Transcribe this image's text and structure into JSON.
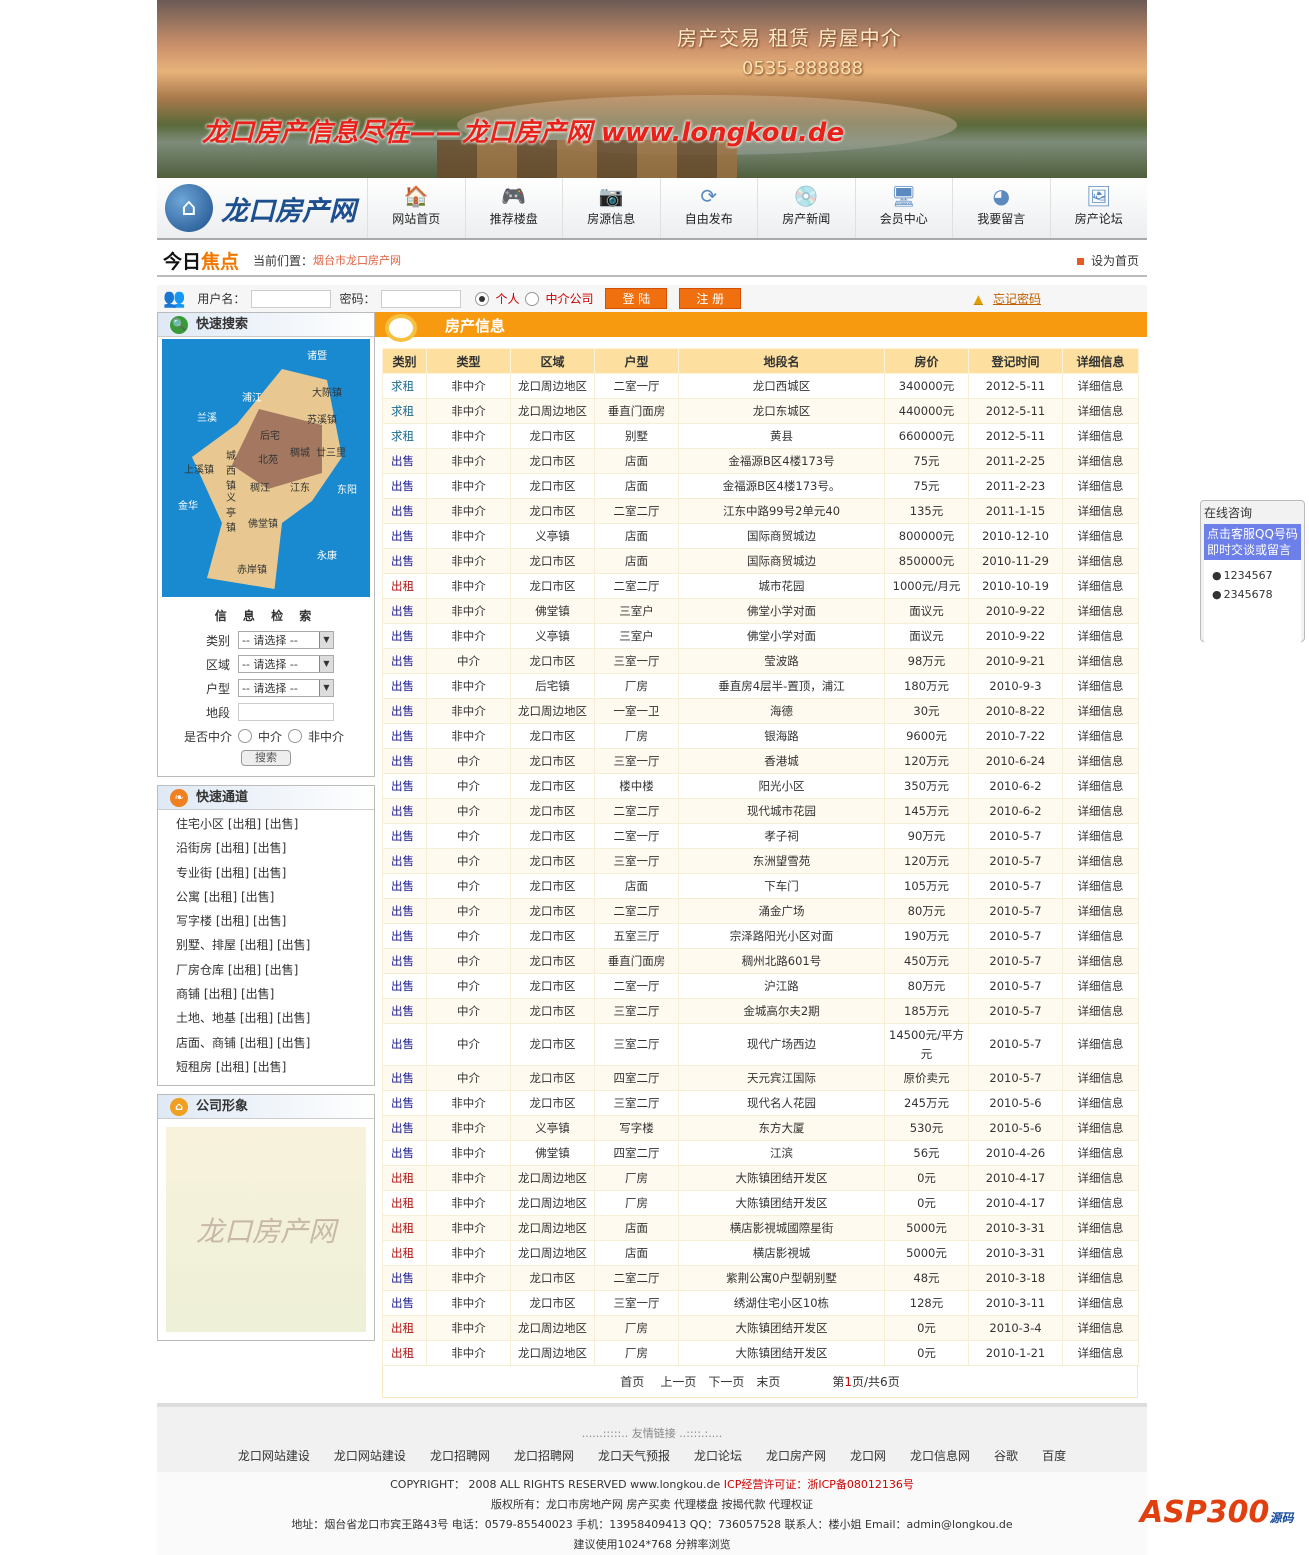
{
  "banner": {
    "slogan1": "房产交易  租赁   房屋中介",
    "phone": "0535-888888",
    "slogan2": "龙口房产信息尽在——龙口房产网  www.longkou.de"
  },
  "logo": "龙口房产网",
  "nav": [
    {
      "label": "网站首页",
      "icon": "home-icon"
    },
    {
      "label": "推荐楼盘",
      "icon": "gamepad-icon"
    },
    {
      "label": "房源信息",
      "icon": "camera-icon"
    },
    {
      "label": "自由发布",
      "icon": "refresh-icon"
    },
    {
      "label": "房产新闻",
      "icon": "disc-icon"
    },
    {
      "label": "会员中心",
      "icon": "computer-icon"
    },
    {
      "label": "我要留言",
      "icon": "pacman-icon"
    },
    {
      "label": "房产论坛",
      "icon": "picture-icon"
    }
  ],
  "crumb": {
    "today": "今日",
    "focus": "焦点",
    "label": "当前们置：",
    "location": "烟台市龙口房产网",
    "set_home": "设为首页"
  },
  "login": {
    "user_label": "用户名：",
    "pass_label": "密码：",
    "opt_personal": "个人",
    "opt_agency": "中介公司",
    "login_btn": "登 陆",
    "register_btn": "注 册",
    "forgot": "忘记密码"
  },
  "left": {
    "quick_search": "快速搜索",
    "map_labels": [
      "诸暨",
      "大陈镇",
      "浦江",
      "苏溪镇",
      "兰溪",
      "后宅",
      "廿三里",
      "稠城",
      "北苑",
      "城西镇",
      "上溪镇",
      "稠江",
      "江东",
      "东阳",
      "金华",
      "义亭镇",
      "佛堂镇",
      "永康",
      "赤岸镇"
    ],
    "search_title": "信 息 检 索",
    "fields": {
      "category": "类别",
      "area": "区域",
      "layout": "户型",
      "location": "地段",
      "is_agency": "是否中介"
    },
    "select_placeholder": "-- 请选择 --",
    "opt_agency": "中介",
    "opt_non_agency": "非中介",
    "search_btn": "搜索",
    "channel_title": "快速通道",
    "channels": [
      "住宅小区 [出租] [出售]",
      "沿街房 [出租] [出售]",
      "专业街 [出租] [出售]",
      "公寓 [出租] [出售]",
      "写字楼 [出租] [出售]",
      "别墅、排屋 [出租] [出售]",
      "厂房仓库 [出租] [出售]",
      "商铺 [出租] [出售]",
      "土地、地基 [出租] [出售]",
      "店面、商铺 [出租] [出售]",
      "短租房 [出租] [出售]"
    ],
    "company_title": "公司形象",
    "company_logo": "龙口房产网"
  },
  "main": {
    "title": "房产信息",
    "columns": [
      "类别",
      "类型",
      "区域",
      "户型",
      "地段名",
      "房价",
      "登记时间",
      "详细信息"
    ],
    "rows": [
      [
        "求租",
        "非中介",
        "龙口周边地区",
        "二室一厅",
        "龙口西城区",
        "340000元",
        "2012-5-11",
        "详细信息"
      ],
      [
        "求租",
        "非中介",
        "龙口周边地区",
        "垂直门面房",
        "龙口东城区",
        "440000元",
        "2012-5-11",
        "详细信息"
      ],
      [
        "求租",
        "非中介",
        "龙口市区",
        "别墅",
        "黄县",
        "660000元",
        "2012-5-11",
        "详细信息"
      ],
      [
        "出售",
        "非中介",
        "龙口市区",
        "店面",
        "金福源B区4楼173号",
        "75元",
        "2011-2-25",
        "详细信息"
      ],
      [
        "出售",
        "非中介",
        "龙口市区",
        "店面",
        "金福源B区4楼173号。",
        "75元",
        "2011-2-23",
        "详细信息"
      ],
      [
        "出售",
        "非中介",
        "龙口市区",
        "二室二厅",
        "江东中路99号2单元40",
        "135元",
        "2011-1-15",
        "详细信息"
      ],
      [
        "出售",
        "非中介",
        "义亭镇",
        "店面",
        "国际商贸城边",
        "800000元",
        "2010-12-10",
        "详细信息"
      ],
      [
        "出售",
        "非中介",
        "龙口市区",
        "店面",
        "国际商贸城边",
        "850000元",
        "2010-11-29",
        "详细信息"
      ],
      [
        "出租",
        "非中介",
        "龙口市区",
        "二室二厅",
        "城市花园",
        "1000元/月元",
        "2010-10-19",
        "详细信息"
      ],
      [
        "出售",
        "非中介",
        "佛堂镇",
        "三室户",
        "佛堂小学对面",
        "面议元",
        "2010-9-22",
        "详细信息"
      ],
      [
        "出售",
        "非中介",
        "义亭镇",
        "三室户",
        "佛堂小学对面",
        "面议元",
        "2010-9-22",
        "详细信息"
      ],
      [
        "出售",
        "中介",
        "龙口市区",
        "三室一厅",
        "莹波路",
        "98万元",
        "2010-9-21",
        "详细信息"
      ],
      [
        "出售",
        "非中介",
        "后宅镇",
        "厂房",
        "垂直房4层半-置顶，浦江",
        "180万元",
        "2010-9-3",
        "详细信息"
      ],
      [
        "出售",
        "非中介",
        "龙口周边地区",
        "一室一卫",
        "海德",
        "30元",
        "2010-8-22",
        "详细信息"
      ],
      [
        "出售",
        "非中介",
        "龙口市区",
        "厂房",
        "银海路",
        "9600元",
        "2010-7-22",
        "详细信息"
      ],
      [
        "出售",
        "中介",
        "龙口市区",
        "三室一厅",
        "香港城",
        "120万元",
        "2010-6-24",
        "详细信息"
      ],
      [
        "出售",
        "中介",
        "龙口市区",
        "楼中楼",
        "阳光小区",
        "350万元",
        "2010-6-2",
        "详细信息"
      ],
      [
        "出售",
        "中介",
        "龙口市区",
        "二室二厅",
        "现代城市花园",
        "145万元",
        "2010-6-2",
        "详细信息"
      ],
      [
        "出售",
        "中介",
        "龙口市区",
        "二室一厅",
        "孝子祠",
        "90万元",
        "2010-5-7",
        "详细信息"
      ],
      [
        "出售",
        "中介",
        "龙口市区",
        "三室一厅",
        "东洲望雪苑",
        "120万元",
        "2010-5-7",
        "详细信息"
      ],
      [
        "出售",
        "中介",
        "龙口市区",
        "店面",
        "下车门",
        "105万元",
        "2010-5-7",
        "详细信息"
      ],
      [
        "出售",
        "中介",
        "龙口市区",
        "二室二厅",
        "涌金广场",
        "80万元",
        "2010-5-7",
        "详细信息"
      ],
      [
        "出售",
        "中介",
        "龙口市区",
        "五室三厅",
        "宗泽路阳光小区对面",
        "190万元",
        "2010-5-7",
        "详细信息"
      ],
      [
        "出售",
        "中介",
        "龙口市区",
        "垂直门面房",
        "稠州北路601号",
        "450万元",
        "2010-5-7",
        "详细信息"
      ],
      [
        "出售",
        "中介",
        "龙口市区",
        "二室一厅",
        "沪江路",
        "80万元",
        "2010-5-7",
        "详细信息"
      ],
      [
        "出售",
        "中介",
        "龙口市区",
        "三室二厅",
        "金城高尔夫2期",
        "185万元",
        "2010-5-7",
        "详细信息"
      ],
      [
        "出售",
        "中介",
        "龙口市区",
        "三室二厅",
        "现代广场西边",
        "14500元/平方元",
        "2010-5-7",
        "详细信息"
      ],
      [
        "出售",
        "中介",
        "龙口市区",
        "四室二厅",
        "天元宾江国际",
        "原价卖元",
        "2010-5-7",
        "详细信息"
      ],
      [
        "出售",
        "非中介",
        "龙口市区",
        "三室二厅",
        "现代名人花园",
        "245万元",
        "2010-5-6",
        "详细信息"
      ],
      [
        "出售",
        "非中介",
        "义亭镇",
        "写字楼",
        "东方大厦",
        "530元",
        "2010-5-6",
        "详细信息"
      ],
      [
        "出售",
        "非中介",
        "佛堂镇",
        "四室二厅",
        "江滨",
        "56元",
        "2010-4-26",
        "详细信息"
      ],
      [
        "出租",
        "非中介",
        "龙口周边地区",
        "厂房",
        "大陈镇团结开发区",
        "0元",
        "2010-4-17",
        "详细信息"
      ],
      [
        "出租",
        "非中介",
        "龙口周边地区",
        "厂房",
        "大陈镇团结开发区",
        "0元",
        "2010-4-17",
        "详细信息"
      ],
      [
        "出租",
        "非中介",
        "龙口周边地区",
        "店面",
        "横店影視城國際星街",
        "5000元",
        "2010-3-31",
        "详细信息"
      ],
      [
        "出租",
        "非中介",
        "龙口周边地区",
        "店面",
        "横店影視城",
        "5000元",
        "2010-3-31",
        "详细信息"
      ],
      [
        "出售",
        "非中介",
        "龙口市区",
        "二室二厅",
        "紫荆公寓0户型朝别墅",
        "48元",
        "2010-3-18",
        "详细信息"
      ],
      [
        "出售",
        "非中介",
        "龙口市区",
        "三室一厅",
        "绣湖住宅小区10栋",
        "128元",
        "2010-3-11",
        "详细信息"
      ],
      [
        "出租",
        "非中介",
        "龙口周边地区",
        "厂房",
        "大陈镇团结开发区",
        "0元",
        "2010-3-4",
        "详细信息"
      ],
      [
        "出租",
        "非中介",
        "龙口周边地区",
        "厂房",
        "大陈镇团结开发区",
        "0元",
        "2010-1-21",
        "详细信息"
      ]
    ],
    "pager": {
      "first": "首页",
      "prev": "上一页",
      "next": "下一页",
      "last": "末页",
      "page_pre": "第",
      "page_cur": "1",
      "page_post": "页/共6页"
    }
  },
  "footer": {
    "friend_title": "......:::::..  友情链接  ..::::.:....",
    "links": [
      "龙口网站建设",
      "龙口网站建设",
      "龙口招聘网",
      "龙口招聘网",
      "龙口天气预报",
      "龙口论坛",
      "龙口房产网",
      "龙口网",
      "龙口信息网",
      "谷歌",
      "百度"
    ],
    "copyright": "COPYRIGHT： 2008 ALL RIGHTS RESERVED www.longkou.de",
    "icp": "ICP经营许可证：浙ICP备08012136号",
    "owner": "版权所有：龙口市房地产网 房产买卖 代理楼盘 按揭代款 代理权证",
    "address": "地址：烟台省龙口市宾王路43号 电话：0579-85540023 手机：13958409413 QQ：736057528 联系人：楼小姐 Email：admin@longkou.de",
    "resolution": "建议使用1024*768 分辨率浏览"
  },
  "float": {
    "title": "在线咨询",
    "notice": "点击客服QQ号码即时交谈或留言",
    "qq": [
      "1234567",
      "2345678"
    ]
  },
  "watermark": {
    "main": "ASP300",
    "sub": "源码"
  }
}
